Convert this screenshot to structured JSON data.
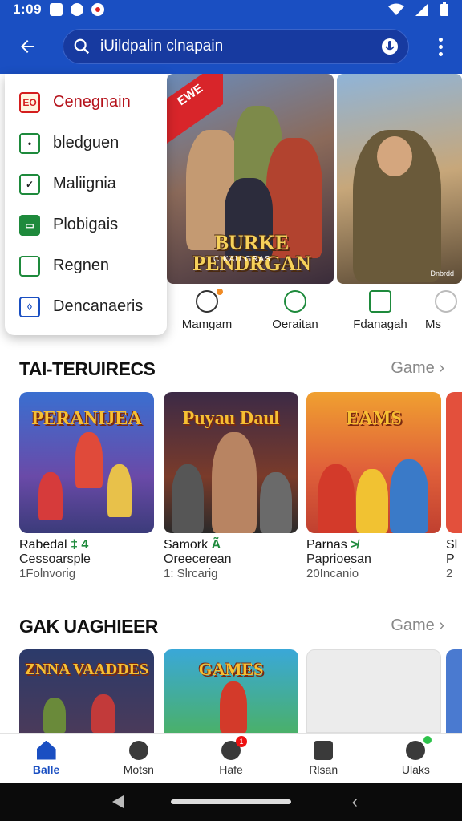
{
  "status_bar": {
    "time": "1:09"
  },
  "search": {
    "query": "iUildpalin clnapain"
  },
  "dropdown_menu": [
    {
      "label": "Cenegnain",
      "icon": "eo-logo-icon",
      "icon_text": "EO"
    },
    {
      "label": "bledguen",
      "icon": "camera-icon"
    },
    {
      "label": "Maliignia",
      "icon": "check-box-icon"
    },
    {
      "label": "Plobigais",
      "icon": "cart-icon"
    },
    {
      "label": "Regnen",
      "icon": "square-icon"
    },
    {
      "label": "Dencanaeris",
      "icon": "shield-icon"
    }
  ],
  "banners": [
    {
      "ribbon": "EWE",
      "title": "BURKE PENDRGAN",
      "subtitle": "CIKAU GRAS"
    },
    {
      "label": "Dnbrdd"
    }
  ],
  "categories": [
    {
      "label": "Mamgam",
      "icon": "wrench-icon"
    },
    {
      "label": "Oeraitan",
      "icon": "check-circle-icon"
    },
    {
      "label": "Fdanagah",
      "icon": "gift-box-icon"
    },
    {
      "label": "Ms"
    }
  ],
  "sections": [
    {
      "title": "TAI-TERUIRECS",
      "link": "Game ›",
      "cards": [
        {
          "logo": "PERANIJEA",
          "line1": "Rabedal",
          "badge": "‡ 4",
          "line2": "Cessoarsple",
          "line3": "1Folnvorig"
        },
        {
          "logo": "Puyau Daul",
          "line1": "Samork",
          "badge": "Ã",
          "line2": "Oreecerean",
          "line3": "1: Slrcarig"
        },
        {
          "logo": "EAMS",
          "line1": "Parnas",
          "badge": "≯",
          "line2": "Paprioesan",
          "line3": "20Incanio"
        },
        {
          "line1": "Sl",
          "badge": "",
          "line2": "P",
          "line3": "2"
        }
      ]
    },
    {
      "title": "GAK UAGHIEER",
      "link": "Game ›",
      "cards": [
        {
          "logo": "ZNNA VAADDES"
        },
        {
          "logo": "GAMES"
        },
        {
          "logo": ""
        },
        {
          "logo": ""
        }
      ]
    }
  ],
  "bottom_nav": [
    {
      "label": "Balle",
      "icon": "home-icon",
      "active": true
    },
    {
      "label": "Motsn",
      "icon": "check-circle-icon"
    },
    {
      "label": "Hafe",
      "icon": "refresh-icon",
      "badge": "1"
    },
    {
      "label": "Rlsan",
      "icon": "grid-icon"
    },
    {
      "label": "Ulaks",
      "icon": "profile-icon"
    }
  ],
  "colors": {
    "primary": "#1a4fc2",
    "accent_green": "#1e8a3c",
    "accent_red": "#d41e1e"
  }
}
